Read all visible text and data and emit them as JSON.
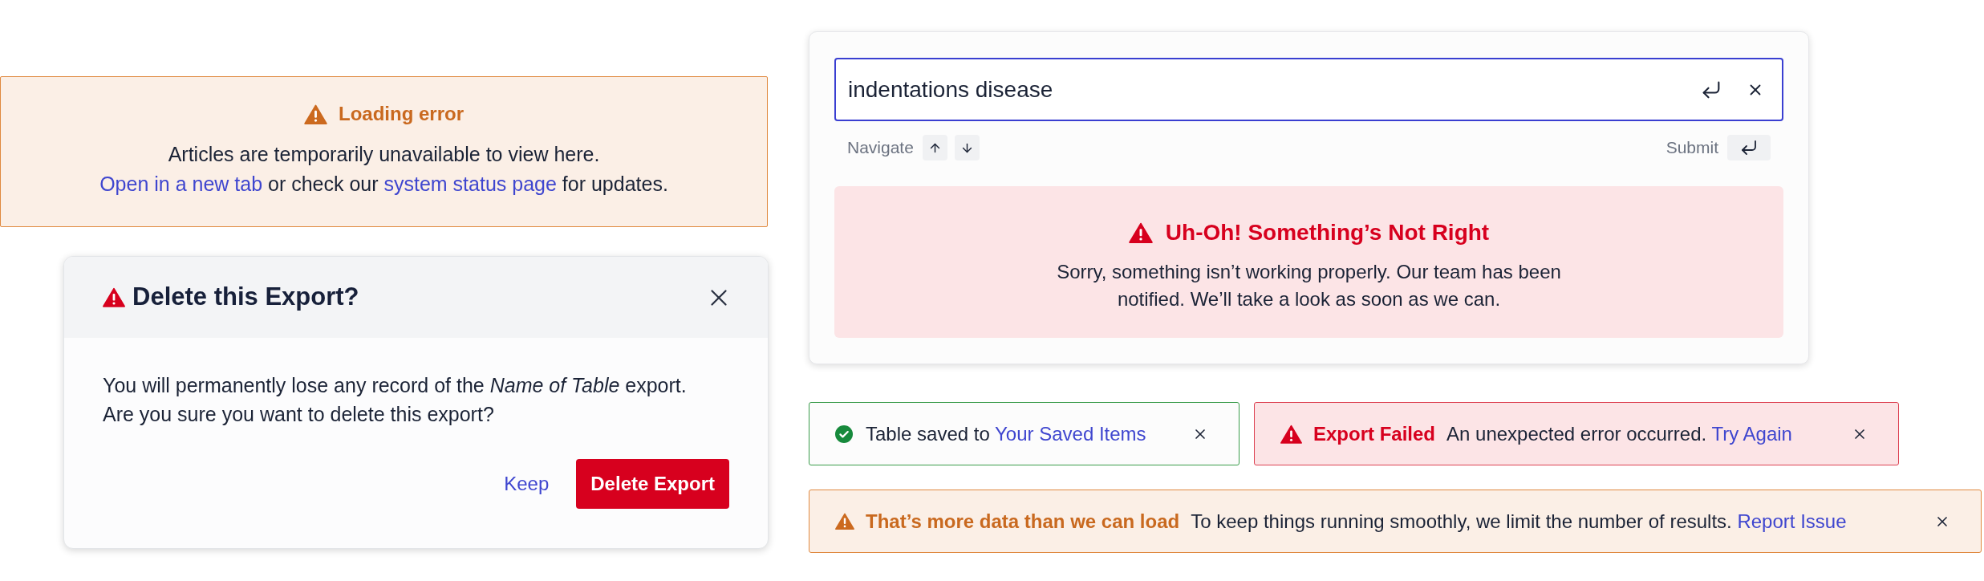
{
  "loading_alert": {
    "title": "Loading error",
    "lines": [
      [
        {
          "kind": "text",
          "text": "Articles are temporarily unavailable to view here."
        }
      ],
      [
        {
          "kind": "link",
          "text": "Open in a new tab"
        },
        {
          "kind": "text",
          "text": " or check our "
        },
        {
          "kind": "link",
          "text": "system status page"
        },
        {
          "kind": "text",
          "text": " for updates."
        }
      ]
    ]
  },
  "delete_dialog": {
    "title": "Delete this Export?",
    "body": [
      "You will permanently lose any record of the *Name of Table* export.",
      "Are you sure you want to delete this export?"
    ],
    "buttons": [
      {
        "kind": "secondary",
        "label": "Keep"
      },
      {
        "kind": "primary",
        "label": "Delete Export"
      }
    ]
  },
  "search_panel": {
    "query": "indentations disease",
    "hints": [
      {
        "kind": "navigate",
        "label": "Navigate"
      },
      {
        "kind": "submit",
        "label": "Submit"
      }
    ],
    "error": {
      "title": "Uh-Oh! Something’s Not Right",
      "message": "Sorry, something isn’t working properly. Our team has been notified. We’ll take a look as soon as we can."
    }
  },
  "toasts": [
    {
      "kind": "success",
      "message": "Table saved to",
      "link": "Your Saved Items"
    },
    {
      "kind": "error",
      "title": "Export Failed",
      "message": "An unexpected error occurred.",
      "link": "Try Again"
    },
    {
      "kind": "warning",
      "title": "That’s more data than we can load",
      "message": "To keep things running smoothly, we limit the number of results.",
      "link": "Report Issue"
    }
  ]
}
